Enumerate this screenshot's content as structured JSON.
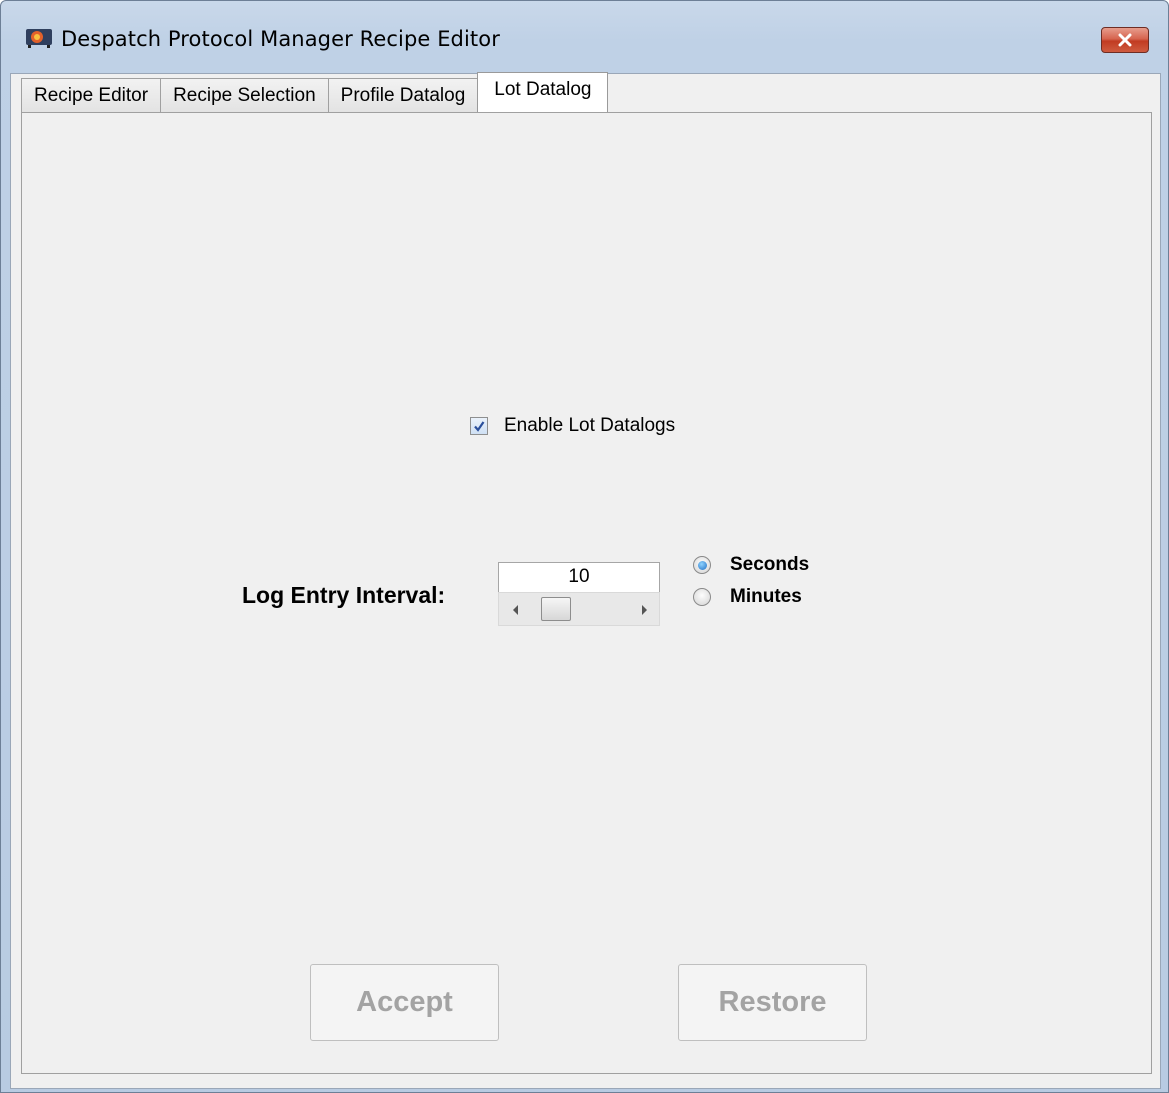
{
  "window": {
    "title": "Despatch Protocol Manager Recipe Editor",
    "app_icon": "oven-icon",
    "close_icon": "close-icon"
  },
  "tabs": [
    {
      "label": "Recipe Editor",
      "active": false
    },
    {
      "label": "Recipe Selection",
      "active": false
    },
    {
      "label": "Profile Datalog",
      "active": false
    },
    {
      "label": "Lot Datalog",
      "active": true
    }
  ],
  "lot_datalog": {
    "enable_label": "Enable Lot Datalogs",
    "enable_checked": true,
    "interval_label": "Log Entry Interval:",
    "interval_value": "10",
    "units": [
      {
        "label": "Seconds",
        "selected": true
      },
      {
        "label": "Minutes",
        "selected": false
      }
    ]
  },
  "buttons": {
    "accept_label": "Accept",
    "restore_label": "Restore",
    "disabled_color": "#a3a3a3"
  },
  "colors": {
    "titlebar": "#c9d8ea",
    "panel_bg": "#f0f0f0",
    "close_button": "#c13b22"
  }
}
